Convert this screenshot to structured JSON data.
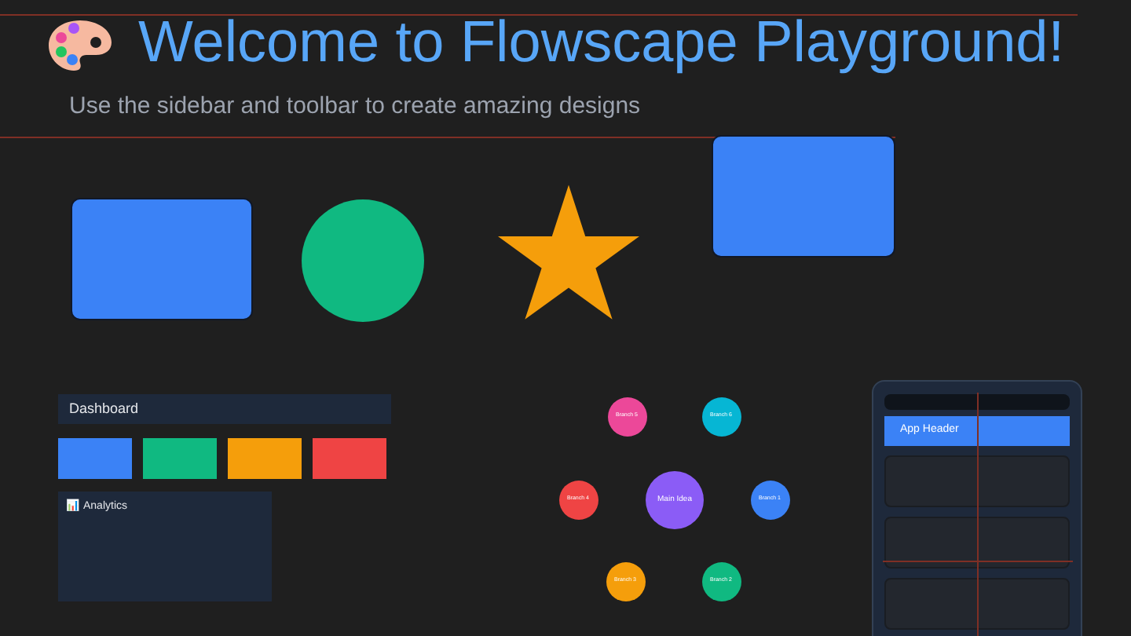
{
  "title": "Welcome to Flowscape Playground!",
  "subtitle": "Use the sidebar and toolbar to create amazing designs",
  "shapes": [
    {
      "kind": "rectangle",
      "color": "#3b82f6"
    },
    {
      "kind": "circle",
      "color": "#10b981"
    },
    {
      "kind": "star",
      "color": "#f59e0b"
    },
    {
      "kind": "rectangle",
      "color": "#3b82f6"
    }
  ],
  "dashboard": {
    "title": "Dashboard",
    "tiles": [
      {
        "color": "#3b82f6"
      },
      {
        "color": "#10b981"
      },
      {
        "color": "#f59e0b"
      },
      {
        "color": "#ef4444"
      }
    ],
    "panel": {
      "icon": "📊",
      "label": "Analytics"
    }
  },
  "mind_map": {
    "center": {
      "label": "Main Idea",
      "color": "#8b5cf6"
    },
    "branches": [
      {
        "label": "Branch 1",
        "color": "#3b82f6"
      },
      {
        "label": "Branch 2",
        "color": "#10b981"
      },
      {
        "label": "Branch 3",
        "color": "#f59e0b"
      },
      {
        "label": "Branch 4",
        "color": "#ef4444"
      },
      {
        "label": "Branch 5",
        "color": "#ec4899"
      },
      {
        "label": "Branch 6",
        "color": "#06b6d4"
      }
    ]
  },
  "mobile_mockup": {
    "header": "App Header"
  }
}
